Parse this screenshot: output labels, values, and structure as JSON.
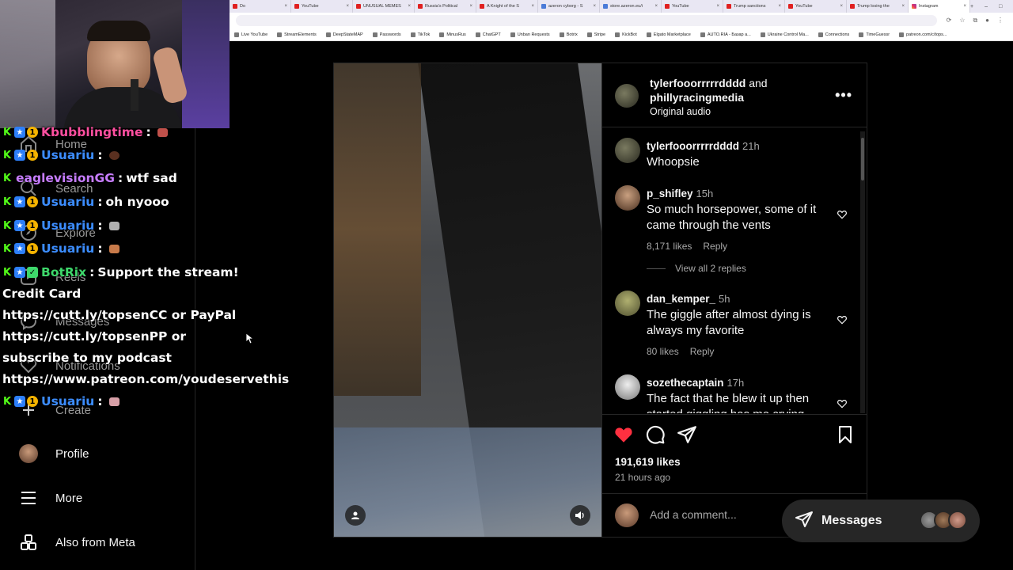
{
  "browser": {
    "tabs": [
      {
        "label": "Do"
      },
      {
        "label": "YouTube"
      },
      {
        "label": "UNUSUAL MEMES"
      },
      {
        "label": "Russia's Political"
      },
      {
        "label": "A Knight of the S"
      },
      {
        "label": "azeron cyborg - S"
      },
      {
        "label": "store.azeron.eu/i"
      },
      {
        "label": "YouTube"
      },
      {
        "label": "Trump sanctions"
      },
      {
        "label": "YouTube"
      },
      {
        "label": "Trump losing the"
      },
      {
        "label": "Instagram"
      }
    ],
    "bookmarks": [
      "Live YouTube",
      "StreamElements",
      "DeepStateMAP",
      "Passwords",
      "TikTok",
      "MinusRus",
      "ChatGPT",
      "Unban Requests",
      "Botrix",
      "Stripe",
      "KickBot",
      "Elgato Marketplace",
      "AUTO.RIA - Базар а...",
      "Ukraine Control Ma...",
      "Connections",
      "TimeGuessr",
      "patreon.com/c/tops..."
    ]
  },
  "sidebar": {
    "items": [
      {
        "label": "Home",
        "icon": "home-icon"
      },
      {
        "label": "Search",
        "icon": "search-icon"
      },
      {
        "label": "Explore",
        "icon": "compass-icon"
      },
      {
        "label": "Reels",
        "icon": "reels-icon"
      },
      {
        "label": "Messages",
        "icon": "messenger-icon"
      },
      {
        "label": "Notifications",
        "icon": "heart-icon"
      },
      {
        "label": "Create",
        "icon": "plus-icon"
      },
      {
        "label": "Profile",
        "icon": "profile-avatar"
      },
      {
        "label": "More",
        "icon": "menu-icon"
      },
      {
        "label": "Also from Meta",
        "icon": "meta-apps-icon"
      }
    ]
  },
  "chat": {
    "lines": [
      {
        "user": "Kbubblingtime",
        "sep": " :",
        "msg": ""
      },
      {
        "user": "Usuariu",
        "sep": " :",
        "msg": ""
      },
      {
        "user": "eaglevisionGG",
        "sep": " :",
        "msg": " wtf sad"
      },
      {
        "user": "Usuariu",
        "sep": " :",
        "msg": " oh nyooo"
      },
      {
        "user": "Usuariu",
        "sep": " :",
        "msg": ""
      },
      {
        "user": "Usuariu",
        "sep": " :",
        "msg": ""
      },
      {
        "user": "BotRix",
        "sep": " :",
        "msg": " Support the stream!"
      }
    ],
    "bot_message": "Credit Card https://cutt.ly/topsenCC or PayPal https://cutt.ly/topsenPP or subscribe to my podcast https://www.patreon.com/youdeservethis",
    "last_line": {
      "user": "Usuariu",
      "sep": " :",
      "msg": ""
    }
  },
  "post": {
    "header": {
      "user1": "tylerfooorrrrrdddd",
      "and": " and",
      "user2": "phillyracingmedia",
      "audio": "Original audio"
    },
    "comments": [
      {
        "user": "tylerfooorrrrrdddd",
        "time": "21h",
        "text": "Whoopsie",
        "likes": "",
        "reply": ""
      },
      {
        "user": "p_shifley",
        "time": "15h",
        "text": "So much horsepower, some of it came through the vents",
        "likes": "8,171 likes",
        "reply": "Reply"
      },
      {
        "user": "dan_kemper_",
        "time": "5h",
        "text": "The giggle after almost dying is always my favorite",
        "likes": "80 likes",
        "reply": "Reply"
      },
      {
        "user": "sozethecaptain",
        "time": "17h",
        "text": "The fact that he blew it up then started giggling has me crying",
        "likes": "",
        "reply": ""
      }
    ],
    "view_replies": "View all 2 replies",
    "likes": "191,619 likes",
    "time_ago": "21 hours ago",
    "add_comment_placeholder": "Add a comment..."
  },
  "messages_pill": {
    "label": "Messages"
  },
  "colors": {
    "like_red": "#ff3040",
    "bg": "#000000",
    "border": "#262626",
    "secondary_text": "#a8a8a8"
  }
}
